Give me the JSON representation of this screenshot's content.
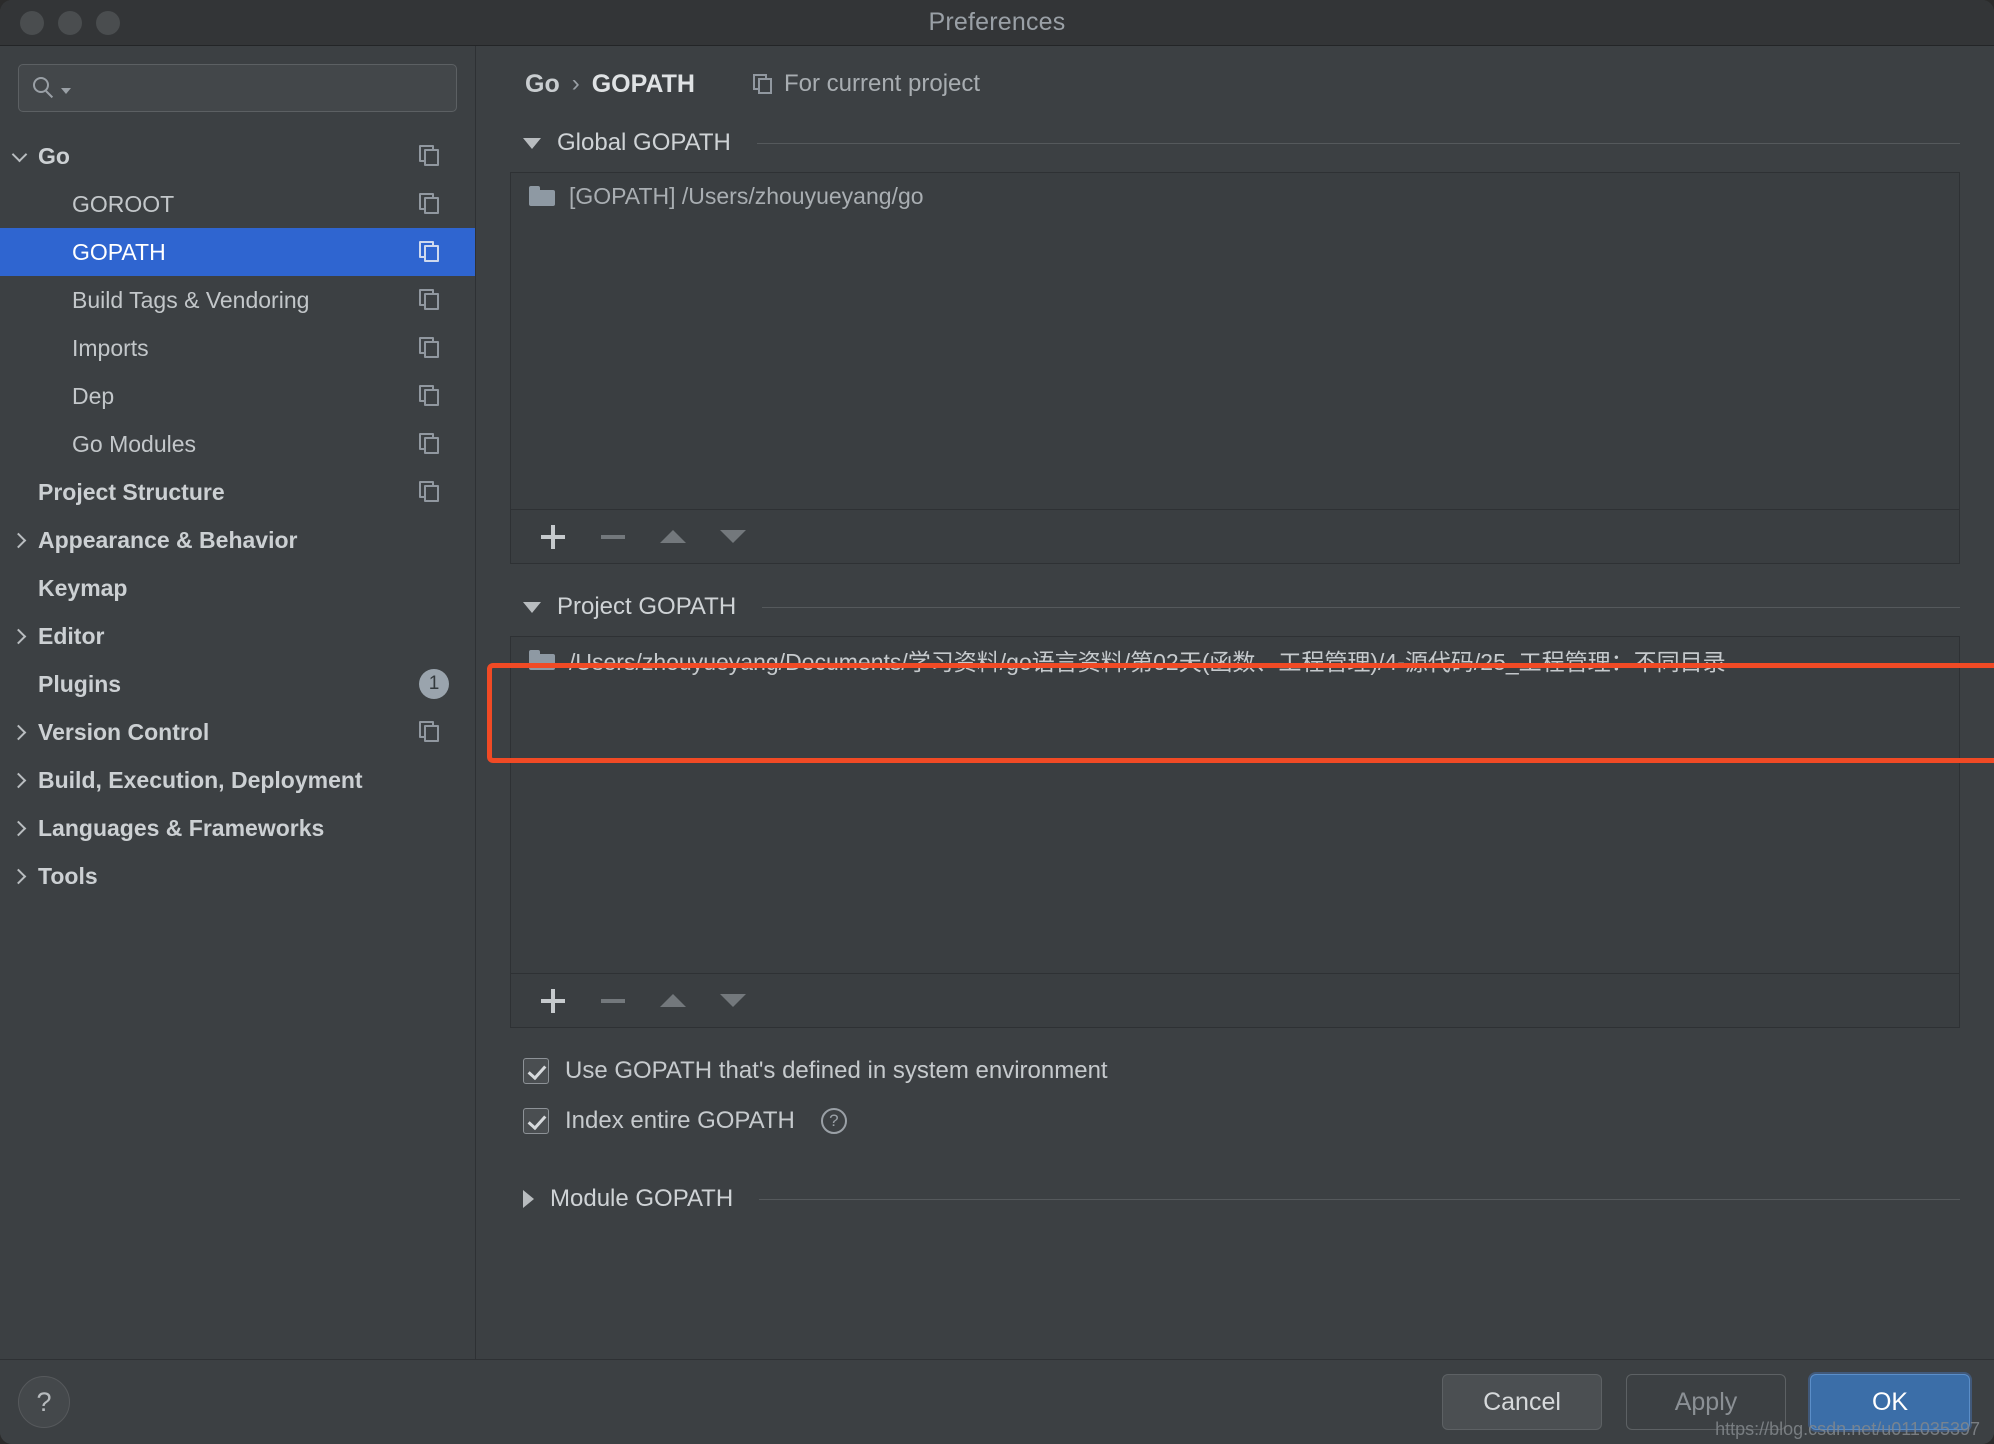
{
  "window": {
    "title": "Preferences",
    "traffic_lights": [
      "close",
      "minimize",
      "zoom"
    ]
  },
  "sidebar": {
    "search": {
      "value": "",
      "placeholder": ""
    },
    "items": [
      {
        "label": "Go",
        "level": 0,
        "bold": true,
        "twisty": "down",
        "copy": true,
        "selected": false
      },
      {
        "label": "GOROOT",
        "level": 1,
        "bold": false,
        "twisty": "",
        "copy": true,
        "selected": false
      },
      {
        "label": "GOPATH",
        "level": 1,
        "bold": false,
        "twisty": "",
        "copy": true,
        "selected": true
      },
      {
        "label": "Build Tags & Vendoring",
        "level": 1,
        "bold": false,
        "twisty": "",
        "copy": true,
        "selected": false
      },
      {
        "label": "Imports",
        "level": 1,
        "bold": false,
        "twisty": "",
        "copy": true,
        "selected": false
      },
      {
        "label": "Dep",
        "level": 1,
        "bold": false,
        "twisty": "",
        "copy": true,
        "selected": false
      },
      {
        "label": "Go Modules",
        "level": 1,
        "bold": false,
        "twisty": "",
        "copy": true,
        "selected": false
      },
      {
        "label": "Project Structure",
        "level": 0,
        "bold": true,
        "twisty": "",
        "copy": true,
        "selected": false
      },
      {
        "label": "Appearance & Behavior",
        "level": 0,
        "bold": true,
        "twisty": "right",
        "copy": false,
        "selected": false
      },
      {
        "label": "Keymap",
        "level": 0,
        "bold": true,
        "twisty": "",
        "copy": false,
        "selected": false
      },
      {
        "label": "Editor",
        "level": 0,
        "bold": true,
        "twisty": "right",
        "copy": false,
        "selected": false
      },
      {
        "label": "Plugins",
        "level": 0,
        "bold": true,
        "twisty": "",
        "copy": false,
        "selected": false,
        "badge": "1"
      },
      {
        "label": "Version Control",
        "level": 0,
        "bold": true,
        "twisty": "right",
        "copy": true,
        "selected": false
      },
      {
        "label": "Build, Execution, Deployment",
        "level": 0,
        "bold": true,
        "twisty": "right",
        "copy": false,
        "selected": false
      },
      {
        "label": "Languages & Frameworks",
        "level": 0,
        "bold": true,
        "twisty": "right",
        "copy": false,
        "selected": false
      },
      {
        "label": "Tools",
        "level": 0,
        "bold": true,
        "twisty": "right",
        "copy": false,
        "selected": false
      }
    ]
  },
  "main": {
    "breadcrumb": {
      "root": "Go",
      "separator": "›",
      "current": "GOPATH",
      "scope_label": "For current project"
    },
    "global_gopath": {
      "title": "Global GOPATH",
      "expanded": true,
      "entries": [
        {
          "text": "[GOPATH] /Users/zhouyueyang/go"
        }
      ]
    },
    "project_gopath": {
      "title": "Project GOPATH",
      "expanded": true,
      "highlighted": true,
      "highlight_color": "#f04a25",
      "entries": [
        {
          "text": "/Users/zhouyueyang/Documents/学习资料/go语言资料/第02天(函数、工程管理)/4-源代码/25_工程管理：不同目录"
        }
      ]
    },
    "module_gopath": {
      "title": "Module GOPATH",
      "expanded": false
    },
    "toolbar_buttons": [
      "add",
      "remove",
      "move-up",
      "move-down"
    ],
    "checkboxes": [
      {
        "label": "Use GOPATH that's defined in system environment",
        "checked": true,
        "help": false
      },
      {
        "label": "Index entire GOPATH",
        "checked": true,
        "help": true
      }
    ]
  },
  "footer": {
    "help": "?",
    "cancel": "Cancel",
    "apply": "Apply",
    "ok": "OK",
    "apply_enabled": false
  },
  "watermark": "https://blog.csdn.net/u011035397",
  "colors": {
    "accent": "#2f65d0",
    "primary_button": "#3b6ea8",
    "annotation": "#f04a25"
  }
}
